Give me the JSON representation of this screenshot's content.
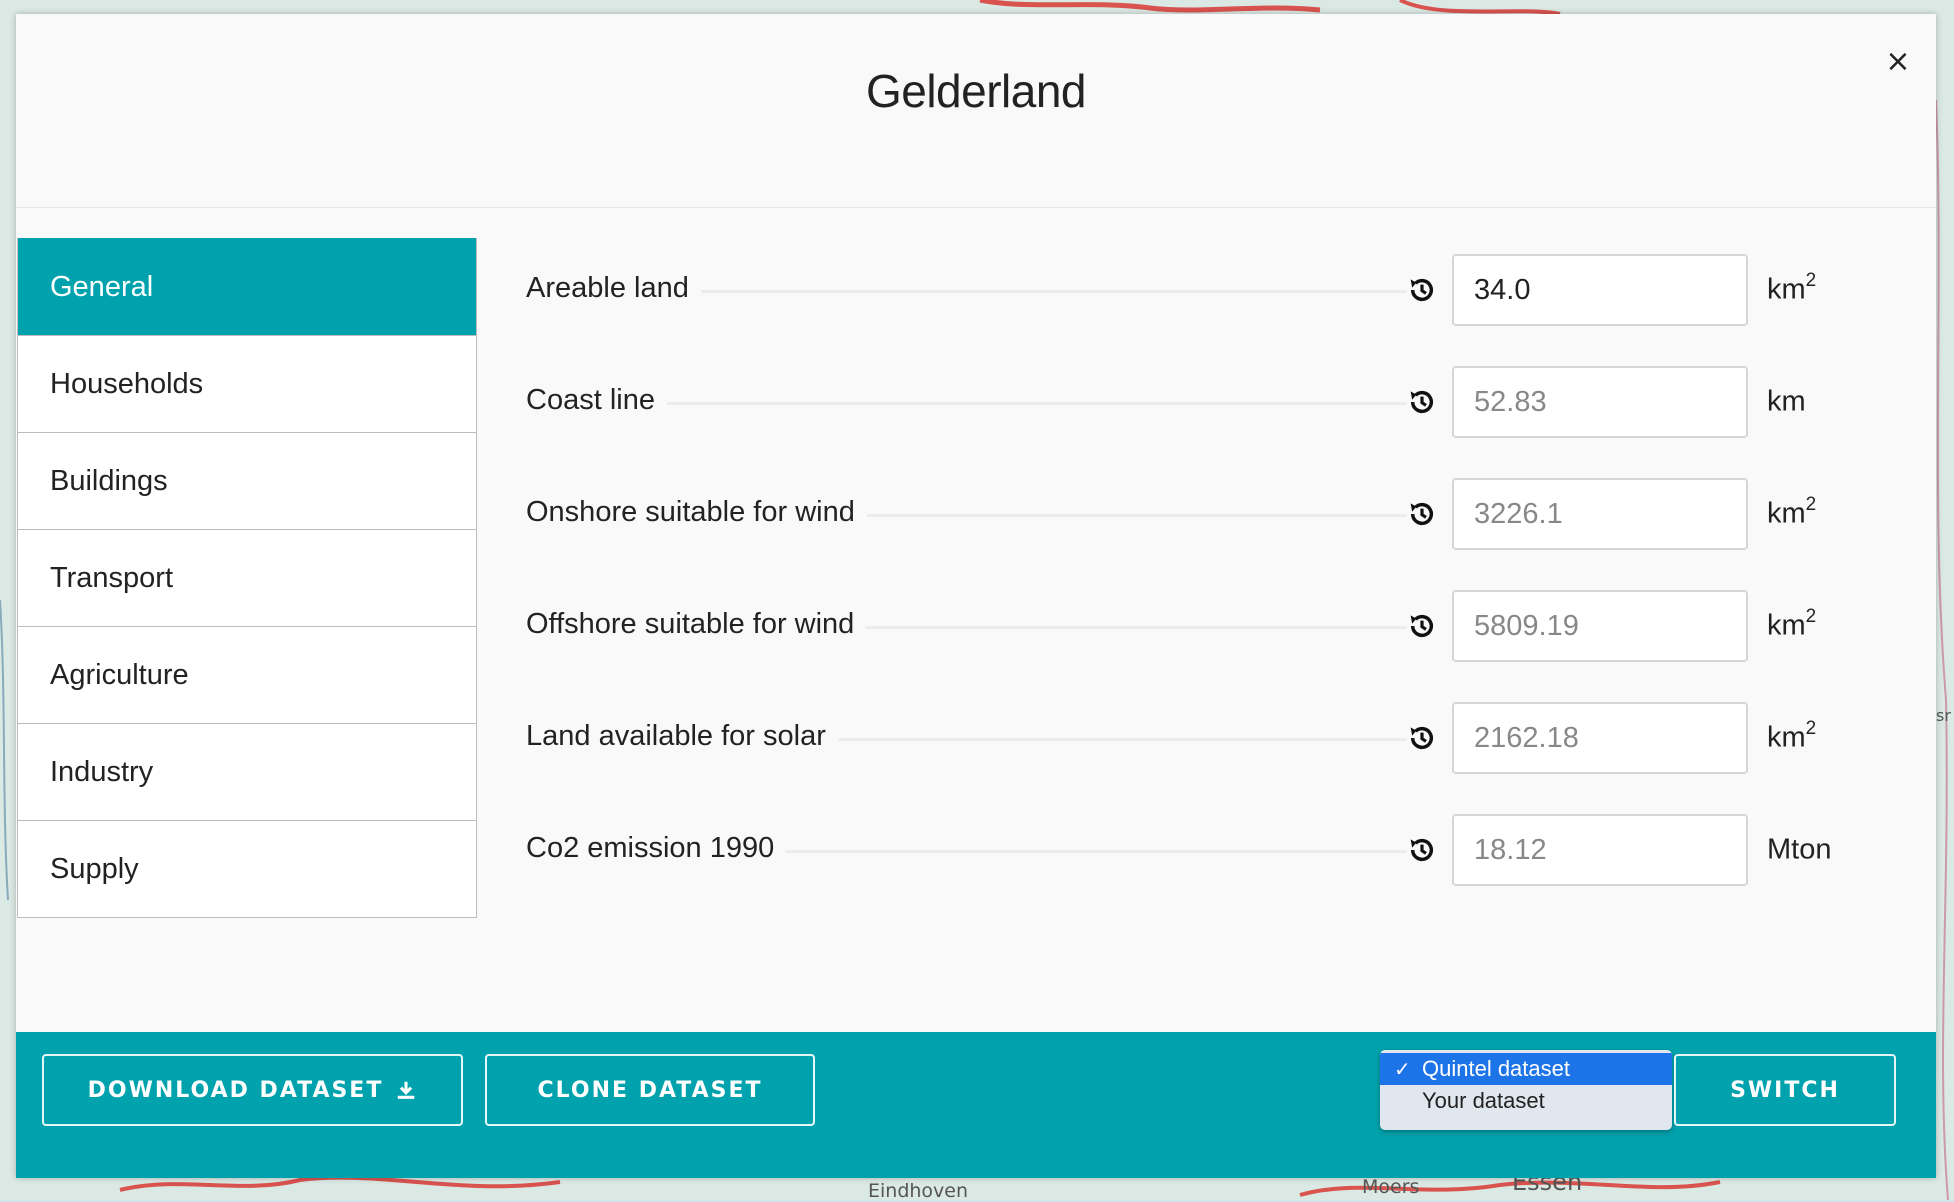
{
  "map": {
    "labels": [
      "Eindhoven",
      "Moers",
      "Essen",
      "sr"
    ]
  },
  "modal": {
    "title": "Gelderland",
    "close_symbol": "×"
  },
  "sidebar": {
    "items": [
      {
        "label": "General",
        "active": true
      },
      {
        "label": "Households",
        "active": false
      },
      {
        "label": "Buildings",
        "active": false
      },
      {
        "label": "Transport",
        "active": false
      },
      {
        "label": "Agriculture",
        "active": false
      },
      {
        "label": "Industry",
        "active": false
      },
      {
        "label": "Supply",
        "active": false
      }
    ]
  },
  "fields": [
    {
      "label": "Areable land",
      "value": "34.0",
      "unit": "km",
      "unit_sup": "2",
      "icon": "reset-history-icon"
    },
    {
      "label": "Coast line",
      "value": "52.83",
      "unit": "km",
      "unit_sup": "",
      "icon": "reset-history-icon"
    },
    {
      "label": "Onshore suitable for wind",
      "value": "3226.1",
      "unit": "km",
      "unit_sup": "2",
      "icon": "reset-history-icon"
    },
    {
      "label": "Offshore suitable for wind",
      "value": "5809.19",
      "unit": "km",
      "unit_sup": "2",
      "icon": "reset-history-icon"
    },
    {
      "label": "Land available for solar",
      "value": "2162.18",
      "unit": "km",
      "unit_sup": "2",
      "icon": "reset-history-icon"
    },
    {
      "label": "Co2 emission 1990",
      "value": "18.12",
      "unit": "Mton",
      "unit_sup": "",
      "icon": "reset-history-icon"
    }
  ],
  "footer": {
    "download_label": "DOWNLOAD DATASET",
    "clone_label": "CLONE DATASET",
    "switch_label": "SWITCH",
    "dataset_options": [
      {
        "label": "Quintel dataset",
        "selected": true
      },
      {
        "label": "Your dataset",
        "selected": false
      }
    ],
    "check_symbol": "✓"
  },
  "colors": {
    "accent": "#00a3ad",
    "select_highlight": "#1d74e8"
  }
}
